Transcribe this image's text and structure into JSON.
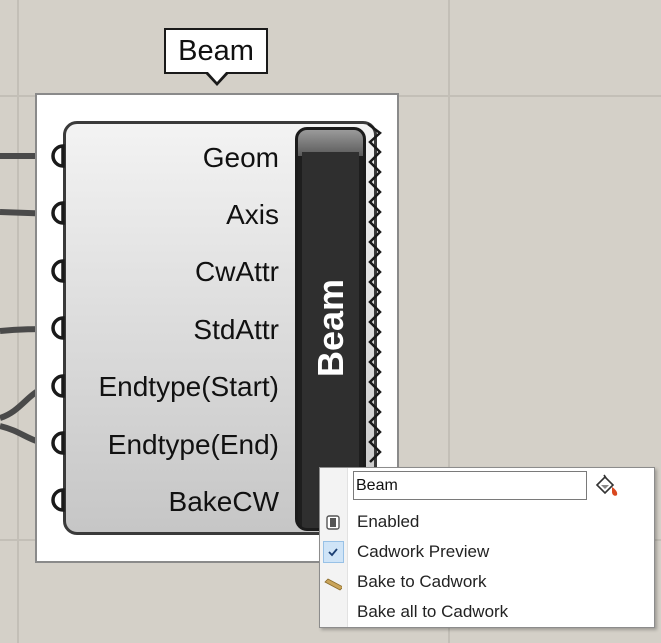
{
  "tooltip": {
    "text": "Beam"
  },
  "component": {
    "nickname": "Beam",
    "inputs": [
      {
        "label": "Geom"
      },
      {
        "label": "Axis"
      },
      {
        "label": "CwAttr"
      },
      {
        "label": "StdAttr"
      },
      {
        "label": "Endtype(Start)"
      },
      {
        "label": "Endtype(End)"
      },
      {
        "label": "BakeCW"
      }
    ]
  },
  "context_menu": {
    "name_value": "Beam",
    "items": [
      {
        "label": "Enabled",
        "icon": "enabled-toggle-icon"
      },
      {
        "label": "Cadwork Preview",
        "icon": "checkmark-icon",
        "checked": true
      },
      {
        "label": "Bake to Cadwork",
        "icon": "bake-icon"
      },
      {
        "label": "Bake all to Cadwork"
      }
    ]
  },
  "colors": {
    "canvas": "#d4d0c8",
    "component_body": "#dcdcdc",
    "nickname_panel": "#2f2f2f",
    "wire": "#4a4a4a",
    "check_highlight": "#cfe4f7"
  }
}
